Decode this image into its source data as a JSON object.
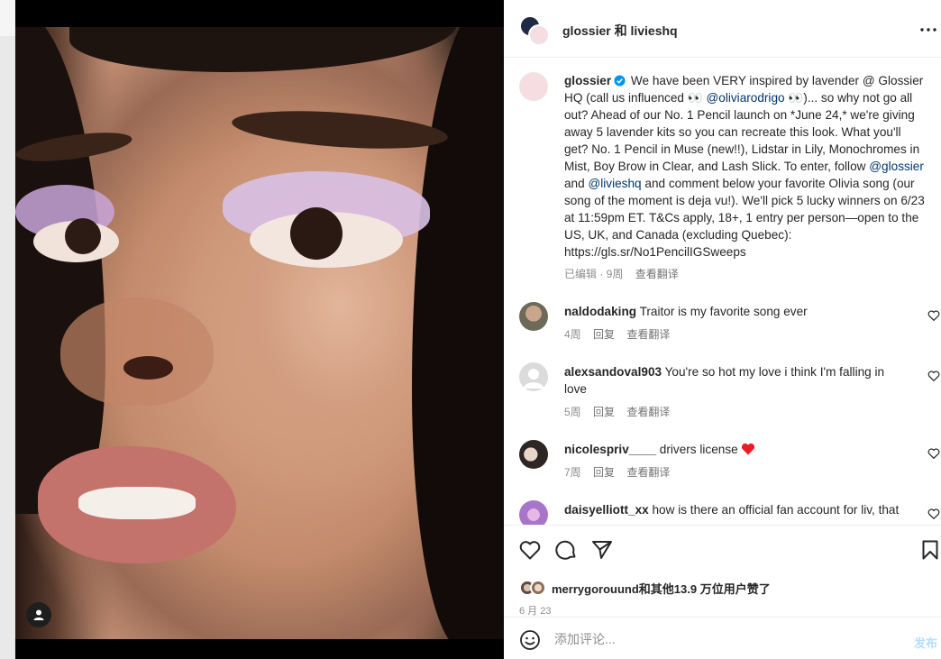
{
  "colors": {
    "accent": "#0095f6",
    "link": "#00376b",
    "muted": "#8e8e8e",
    "heart_red": "#ed4956"
  },
  "header": {
    "title": "glossier 和 livieshq",
    "more_icon": "more-horizontal-icon"
  },
  "caption": {
    "username": "glossier",
    "text_1": " We have been VERY inspired by lavender @ Glossier HQ (call us influenced ",
    "emoji_eyes": "👀",
    "mention_1": "@oliviarodrigo",
    "text_2": ")... so why not go all out? Ahead of our No. 1 Pencil launch on *June 24,* we're giving away 5 lavender kits so you can recreate this look. What you'll get? No. 1 Pencil in Muse (new!!), Lidstar in Lily, Monochromes in Mist, Boy Brow in Clear, and Lash Slick. To enter, follow ",
    "mention_2": "@glossier",
    "text_3": " and ",
    "mention_3": "@livieshq",
    "text_4": " and comment below your favorite Olivia song (our song of the moment is deja vu!). We'll pick 5 lucky winners on 6/23 at 11:59pm ET. T&Cs apply, 18+, 1 entry per person—open to the US, UK, and Canada (excluding Quebec): https://gls.sr/No1PencilIGSweeps",
    "edited": "已编辑 · 9周",
    "translate": "查看翻译"
  },
  "comments": [
    {
      "username": "naldodaking",
      "text": "Traitor is my favorite song ever",
      "time": "4周",
      "reply": "回复",
      "translate": "查看翻译"
    },
    {
      "username": "alexsandoval903",
      "text": "You're so hot my love i think I'm falling in love",
      "time": "5周",
      "reply": "回复",
      "translate": "查看翻译"
    },
    {
      "username": "nicolespriv____",
      "text": "drivers license ",
      "time": "7周",
      "reply": "回复",
      "translate": "查看翻译"
    },
    {
      "username": "daisyelliott_xx",
      "text": "how is there an official fan account for liv, that",
      "time": "",
      "reply": "",
      "translate": ""
    }
  ],
  "actions": {
    "like_icon": "heart-icon",
    "comment_icon": "comment-icon",
    "share_icon": "send-icon",
    "save_icon": "bookmark-icon"
  },
  "likes": {
    "text": "merrygorouund和其他13.9 万位用户赞了"
  },
  "post_date": "6 月 23",
  "composer": {
    "placeholder": "添加评论...",
    "post_label": "发布"
  }
}
